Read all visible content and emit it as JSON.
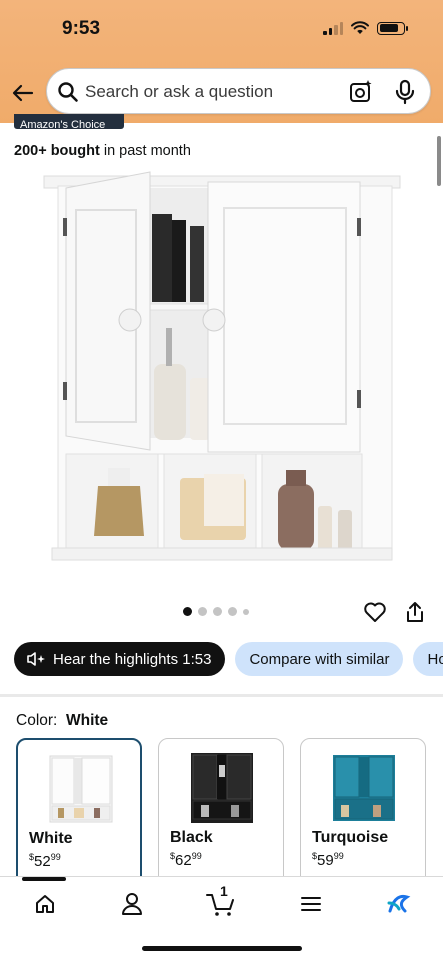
{
  "status_bar": {
    "time": "9:53"
  },
  "search": {
    "placeholder": "Search or ask a question"
  },
  "badge": {
    "text": "Amazon's Choice"
  },
  "social_proof": {
    "count": "200+ bought",
    "suffix": " in past month"
  },
  "gallery": {
    "image_count": 5,
    "active_index": 0
  },
  "chips": [
    {
      "label": "Hear the highlights 1:53"
    },
    {
      "label": "Compare with similar"
    },
    {
      "label": "Ho"
    }
  ],
  "color": {
    "label": "Color:",
    "selected": "White",
    "options": [
      {
        "name": "White",
        "price_whole": "$52",
        "price_fraction": "99",
        "selected": true
      },
      {
        "name": "Black",
        "price_whole": "$62",
        "price_fraction": "99",
        "selected": false
      },
      {
        "name": "Turquoise",
        "price_whole": "$59",
        "price_fraction": "99",
        "selected": false
      }
    ]
  },
  "nav": {
    "cart_count": "1"
  },
  "colors": {
    "header": "#f0ab6a",
    "chip_blue": "#cfe3fb",
    "selected_border": "#1d4e6e"
  }
}
